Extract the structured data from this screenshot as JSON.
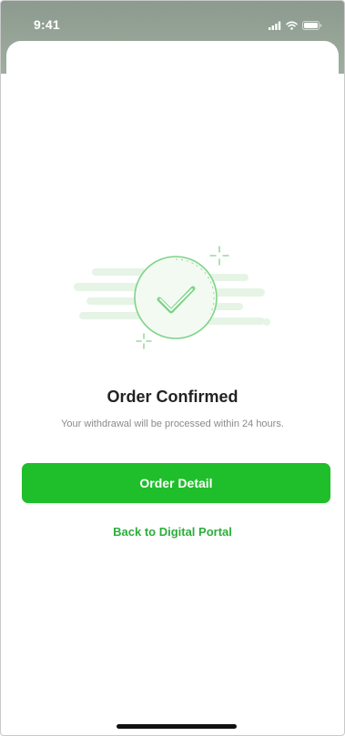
{
  "status_bar": {
    "time": "9:41",
    "icons": [
      "cellular-signal-icon",
      "wifi-icon",
      "battery-icon"
    ]
  },
  "illustration": {
    "icon": "check-circle-icon",
    "accent_color": "#7fd389",
    "bg_shape_color": "#e6f4e6"
  },
  "content": {
    "title": "Order Confirmed",
    "subtitle": "Your withdrawal will be processed within 24 hours."
  },
  "actions": {
    "primary_label": "Order Detail",
    "secondary_label": "Back to Digital Portal",
    "primary_color": "#1fbe2b",
    "link_color": "#2cae3a"
  }
}
